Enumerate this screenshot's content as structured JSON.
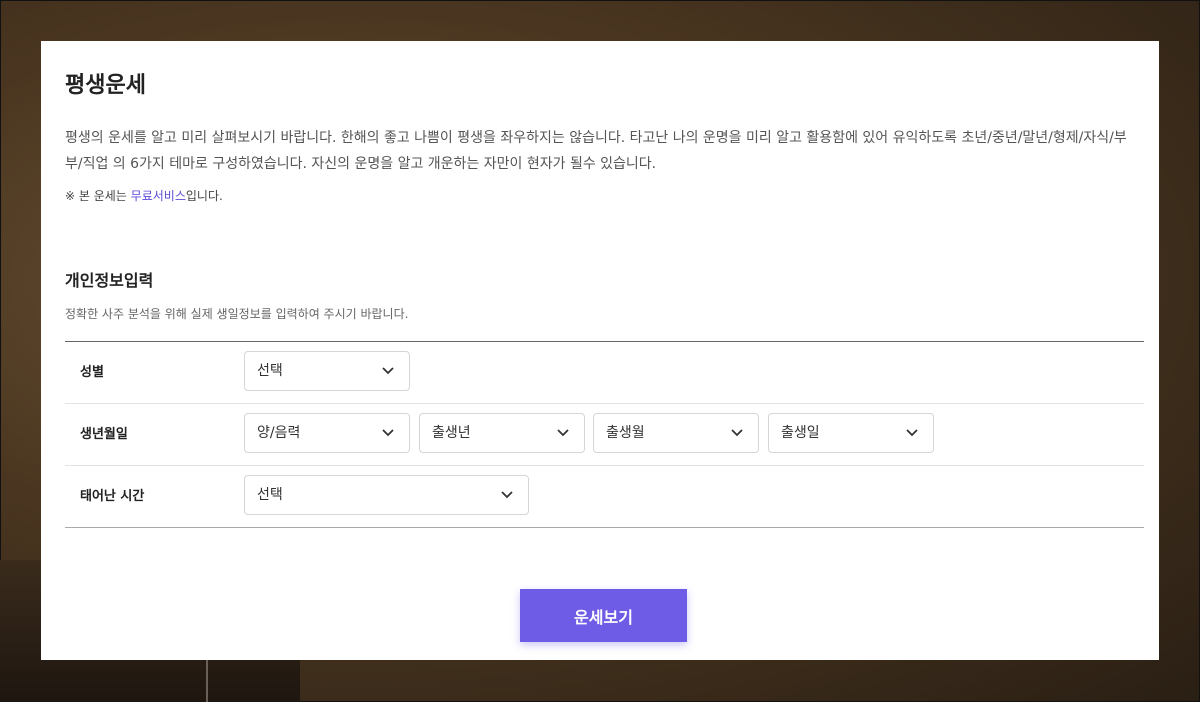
{
  "page": {
    "title": "평생운세",
    "description": "평생의 운세를 알고 미리 살펴보시기 바랍니다. 한해의 좋고 나쁨이 평생을 좌우하지는 않습니다. 타고난 나의 운명을 미리 알고 활용함에 있어 유익하도록 초년/중년/말년/형제/자식/부부/직업 의 6가지 테마로 구성하였습니다. 자신의 운명을 알고 개운하는 자만이 현자가 될수 있습니다.",
    "notice_prefix": "※ 본 운세는 ",
    "notice_link": "무료서비스",
    "notice_suffix": "입니다."
  },
  "form": {
    "section_title": "개인정보입력",
    "section_desc": "정확한 사주 분석을 위해 실제 생일정보를 입력하여 주시기 바랍니다.",
    "gender": {
      "label": "성별",
      "value": "선택"
    },
    "birth": {
      "label": "생년월일",
      "calendar": "양/음력",
      "year": "출생년",
      "month": "출생월",
      "day": "출생일"
    },
    "time": {
      "label": "태어난 시간",
      "value": "선택"
    },
    "submit_label": "운세보기"
  },
  "colors": {
    "accent": "#6e5ce6",
    "link": "#5b4bd6"
  },
  "icons": {
    "select_arrow": "chevron-down-icon"
  }
}
